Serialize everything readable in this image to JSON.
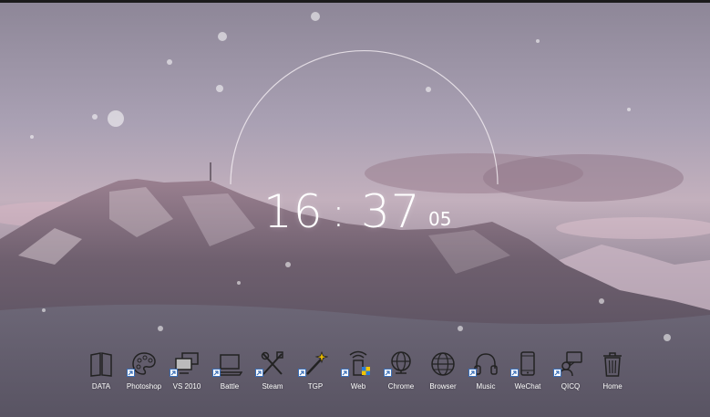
{
  "clock": {
    "hours": "16",
    "separator": ":",
    "minutes": "37",
    "seconds": "05"
  },
  "dock": {
    "items": [
      {
        "label": "DATA",
        "icon": "book-icon"
      },
      {
        "label": "Photoshop",
        "icon": "palette-icon"
      },
      {
        "label": "VS 2010",
        "icon": "monitors-icon"
      },
      {
        "label": "Battle",
        "icon": "laptop-icon"
      },
      {
        "label": "Steam",
        "icon": "tools-icon"
      },
      {
        "label": "TGP",
        "icon": "magic-wand-icon"
      },
      {
        "label": "Web",
        "icon": "wireless-device-icon"
      },
      {
        "label": "Chrome",
        "icon": "globe-icon"
      },
      {
        "label": "Browser",
        "icon": "web-globe-icon"
      },
      {
        "label": "Music",
        "icon": "headphones-icon"
      },
      {
        "label": "WeChat",
        "icon": "phone-icon"
      },
      {
        "label": "QICQ",
        "icon": "chat-icon"
      },
      {
        "label": "Home",
        "icon": "trash-icon"
      }
    ]
  },
  "colors": {
    "text": "#ffffff",
    "icon_stroke": "#222222",
    "shortcut_arrow": "#3a6fb8"
  }
}
